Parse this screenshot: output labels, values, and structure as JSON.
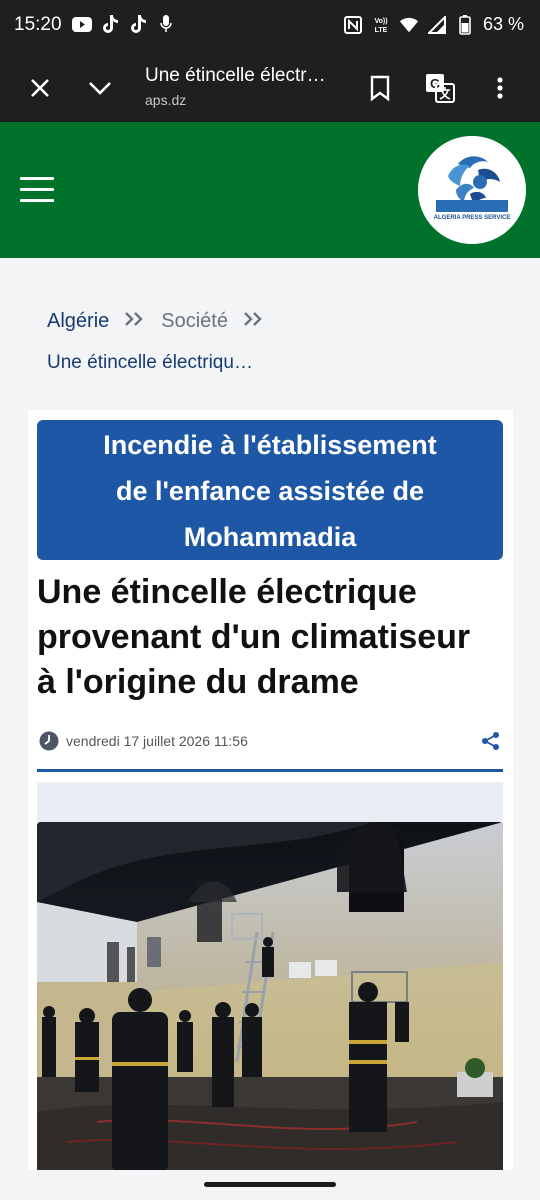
{
  "status_bar": {
    "time": "15:20",
    "left_icons": [
      "youtube-icon",
      "tiktok-icon",
      "tiktok-icon",
      "microphone-icon"
    ],
    "right_icons": [
      "nfc-icon",
      "volte-icon",
      "wifi-icon",
      "signal-icon",
      "battery-icon"
    ],
    "volte_top": "Vo))",
    "volte_bottom": "LTE",
    "battery": "63 %"
  },
  "tab_bar": {
    "title": "Une étincelle électr…",
    "url": "aps.dz",
    "icons": [
      "close-icon",
      "chevron-down-icon",
      "bookmark-icon",
      "translate-icon",
      "more-vert-icon"
    ]
  },
  "site_header": {
    "logo_text": "ALGERIA PRESS SERVICE",
    "colors": {
      "header_bg": "#00722b",
      "accent_blue": "#1e57a6"
    }
  },
  "breadcrumb": {
    "home": "Algérie",
    "separator": "»",
    "category": "Société",
    "current": "Une étincelle électriqu…"
  },
  "article": {
    "banner_lines": [
      "Incendie à l'établissement",
      "de l'enfance assistée de",
      "Mohammadia"
    ],
    "headline_lines": [
      "Une étincelle électrique",
      "provenant d'un climatiseur",
      "à l'origine du drame"
    ],
    "date": "vendredi 17 juillet 2026 11:56"
  }
}
